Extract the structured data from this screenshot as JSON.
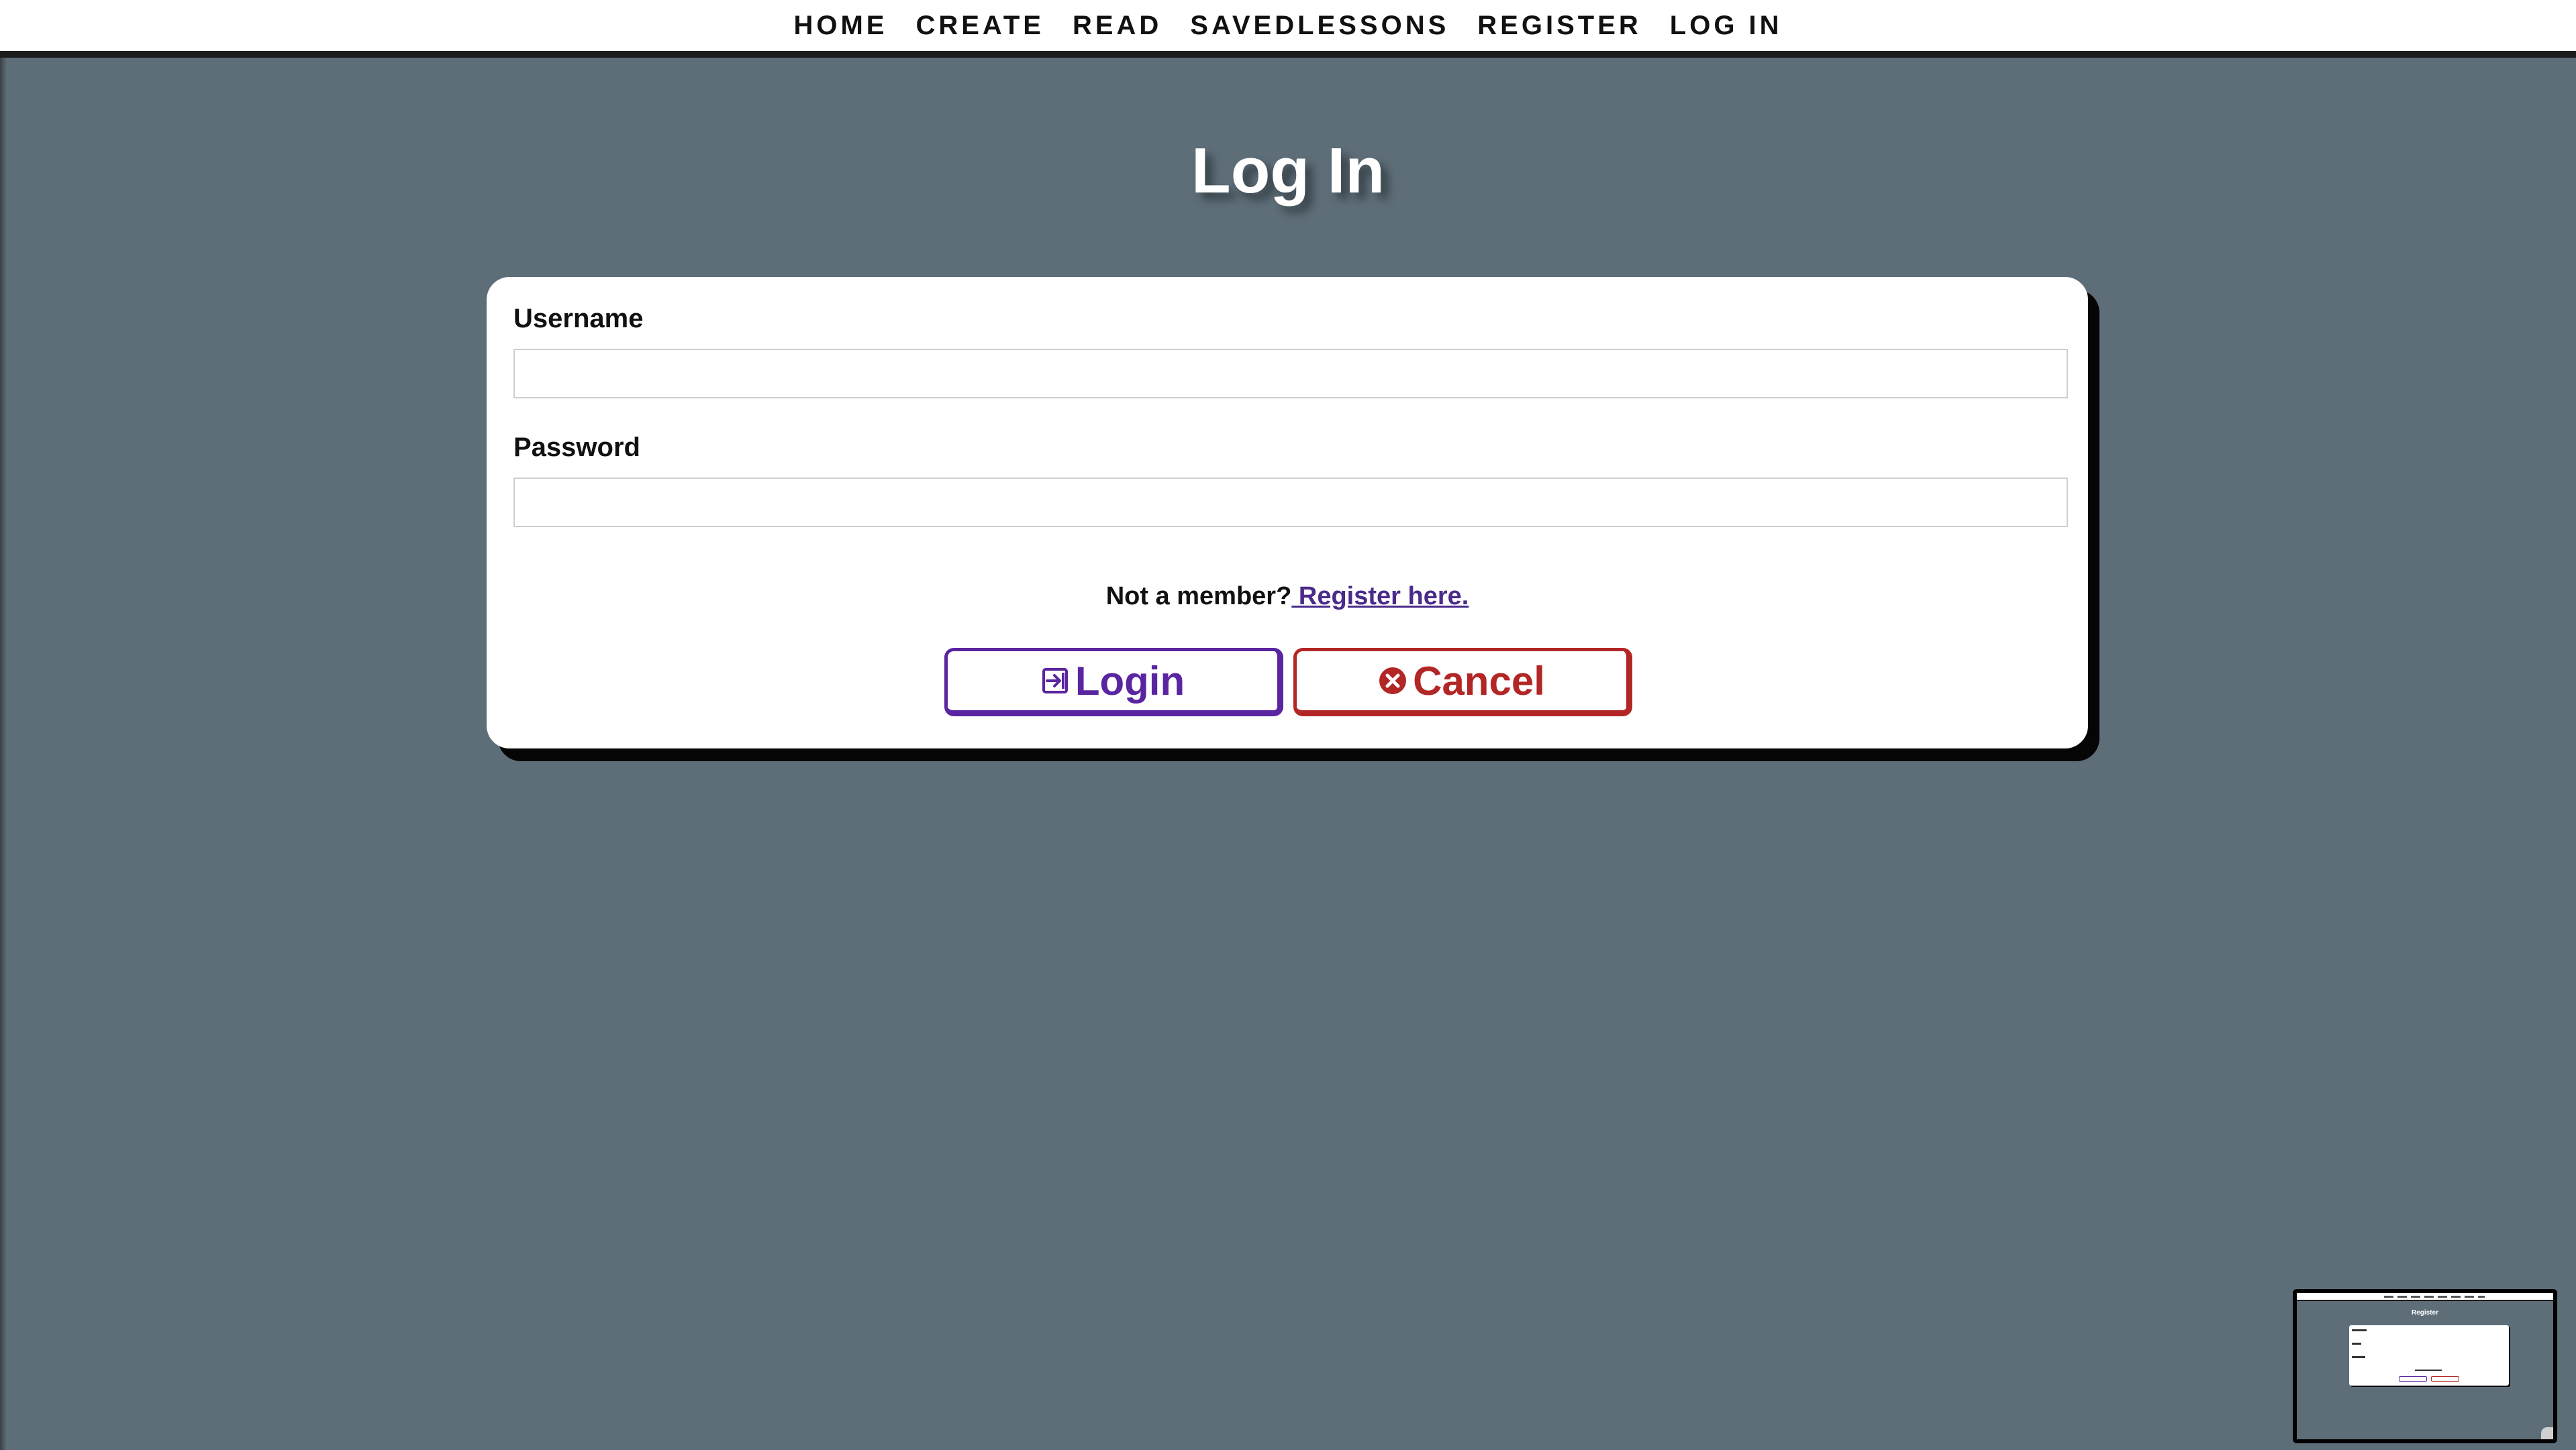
{
  "nav": {
    "items": [
      "HOME",
      "CREATE",
      "READ",
      "SAVEDLESSONS",
      "REGISTER",
      "LOG IN"
    ]
  },
  "page": {
    "title": "Log In"
  },
  "form": {
    "username_label": "Username",
    "username_value": "",
    "password_label": "Password",
    "password_value": "",
    "member_prompt": "Not a member?",
    "register_link": " Register here.",
    "login_label": "Login",
    "cancel_label": "Cancel"
  },
  "thumbnail": {
    "title": "Register"
  },
  "colors": {
    "background": "#5e6e79",
    "login_accent": "#5a25a0",
    "cancel_accent": "#b32626",
    "link": "#4a2a8a"
  },
  "icons": {
    "login": "login-arrow-icon",
    "cancel": "close-circle-icon"
  }
}
